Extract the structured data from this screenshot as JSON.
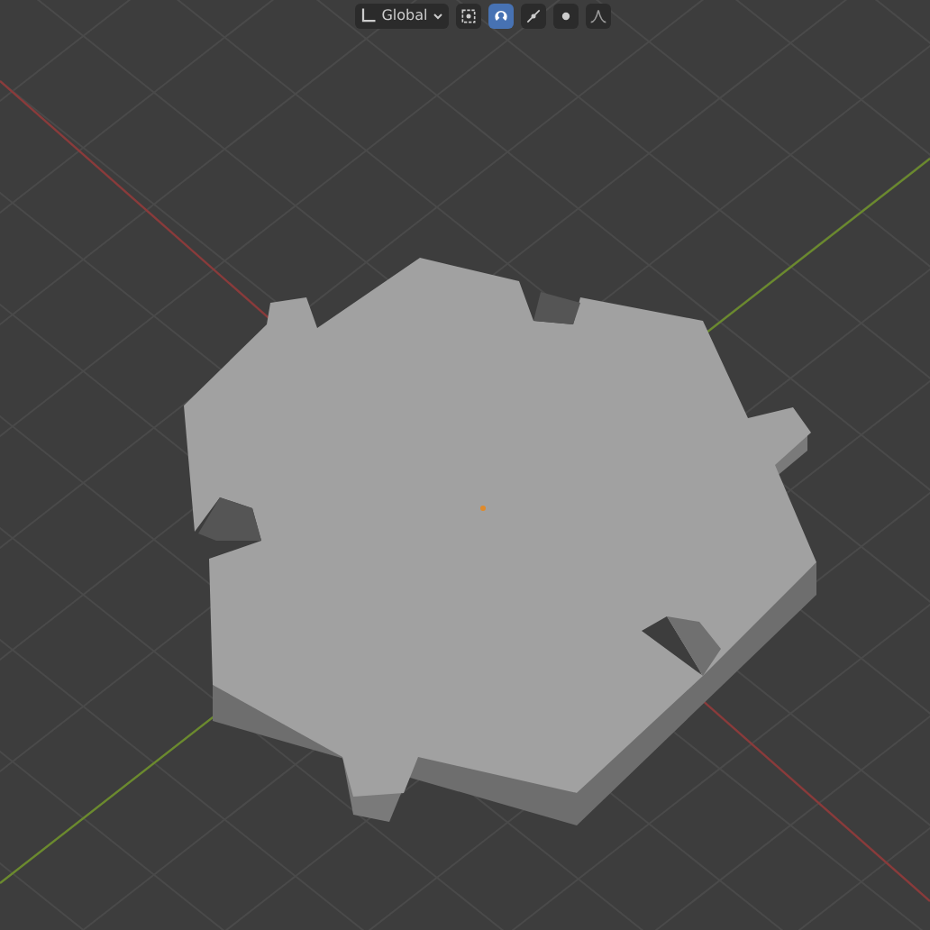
{
  "header": {
    "orientation": {
      "label": "Global"
    },
    "tools": [
      {
        "kind": "pivot",
        "active": false
      },
      {
        "kind": "snap",
        "active": true
      },
      {
        "kind": "snap-target",
        "active": false
      },
      {
        "kind": "proportional",
        "active": false
      },
      {
        "kind": "falloff",
        "active": false
      }
    ]
  }
}
